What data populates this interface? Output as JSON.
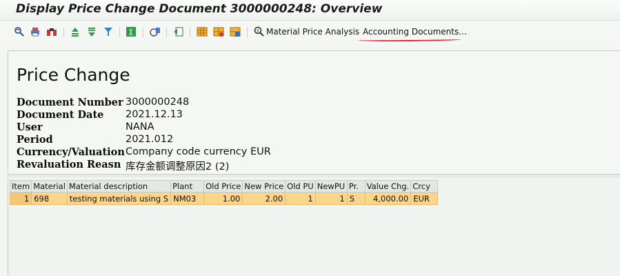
{
  "window": {
    "title": "Display Price Change Document 3000000248: Overview"
  },
  "toolbar": {
    "icons": [
      "detail-icon",
      "print-icon",
      "find-icon",
      "sort-ascending-icon",
      "sort-descending-icon",
      "filter-icon",
      "sum-icon",
      "subtotal-icon",
      "export-icon",
      "layout-select-icon",
      "layout-change-icon",
      "layout-save-icon",
      "material-analysis-icon"
    ],
    "material_price_analysis_label": "Material Price Analysis",
    "accounting_documents_label": "Accounting Documents..."
  },
  "header": {
    "panel_title": "Price Change",
    "fields": [
      {
        "label": "Document Number",
        "value": "3000000248"
      },
      {
        "label": "Document Date",
        "value": "2021.12.13"
      },
      {
        "label": "User",
        "value": "NANA"
      },
      {
        "label": "Period",
        "value": "2021.012"
      },
      {
        "label": "Currency/Valuation",
        "value": "Company code currency EUR"
      },
      {
        "label": "Revaluation Reasn",
        "value": "库存金额调整原因2 (2)"
      }
    ]
  },
  "table": {
    "columns": [
      "Item",
      "Material",
      "Material description",
      "Plant",
      "Old Price",
      "New Price",
      "Old PU",
      "NewPU",
      "Pr.",
      "Value Chg.",
      "Crcy"
    ],
    "rows": [
      {
        "item": "1",
        "material": "698",
        "description": "testing materials using S",
        "plant": "NM03",
        "old_price": "1.00",
        "new_price": "2.00",
        "old_pu": "1",
        "new_pu": "1",
        "pr": "S",
        "value_chg": "4,000.00",
        "crcy": "EUR"
      }
    ]
  },
  "colors": {
    "row_highlight": "#fbd58c",
    "annotation_underline": "#e0252a"
  }
}
